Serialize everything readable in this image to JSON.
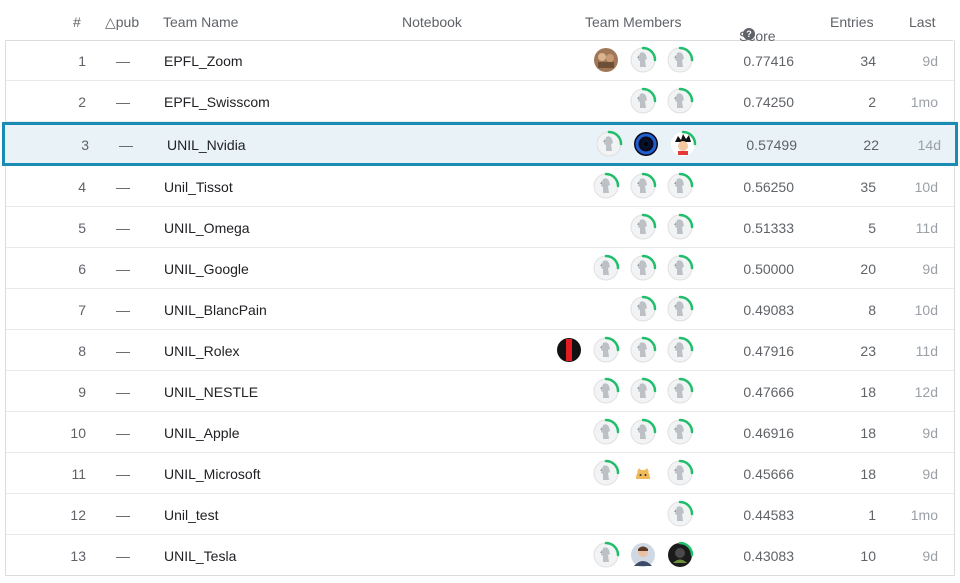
{
  "header": {
    "rank": "#",
    "delta": "△pub",
    "team": "Team Name",
    "notebook": "Notebook",
    "members": "Team Members",
    "score": "Score",
    "entries": "Entries",
    "last": "Last"
  },
  "colors": {
    "highlight_border": "#1a8bb3",
    "highlight_bg": "#e8f2f7",
    "progress_ring": "#20be6b"
  },
  "rows": [
    {
      "rank": "1",
      "delta": "—",
      "team": "EPFL_Zoom",
      "score": "0.77416",
      "entries": "34",
      "last": "9d",
      "members": [
        "photo-avatar",
        "default-avatar",
        "default-avatar"
      ]
    },
    {
      "rank": "2",
      "delta": "—",
      "team": "EPFL_Swisscom",
      "score": "0.74250",
      "entries": "2",
      "last": "1mo",
      "members": [
        "default-avatar",
        "default-avatar"
      ]
    },
    {
      "rank": "3",
      "delta": "—",
      "team": "UNIL_Nvidia",
      "score": "0.57499",
      "entries": "22",
      "last": "14d",
      "members": [
        "default-avatar",
        "vortex-avatar",
        "cartoon-avatar"
      ]
    },
    {
      "rank": "4",
      "delta": "—",
      "team": "Unil_Tissot",
      "score": "0.56250",
      "entries": "35",
      "last": "10d",
      "members": [
        "default-avatar",
        "default-avatar",
        "default-avatar"
      ]
    },
    {
      "rank": "5",
      "delta": "—",
      "team": "UNIL_Omega",
      "score": "0.51333",
      "entries": "5",
      "last": "11d",
      "members": [
        "default-avatar",
        "default-avatar"
      ]
    },
    {
      "rank": "6",
      "delta": "—",
      "team": "UNIL_Google",
      "score": "0.50000",
      "entries": "20",
      "last": "9d",
      "members": [
        "default-avatar",
        "default-avatar",
        "default-avatar"
      ]
    },
    {
      "rank": "7",
      "delta": "—",
      "team": "UNIL_BlancPain",
      "score": "0.49083",
      "entries": "8",
      "last": "10d",
      "members": [
        "default-avatar",
        "default-avatar"
      ]
    },
    {
      "rank": "8",
      "delta": "—",
      "team": "UNIL_Rolex",
      "score": "0.47916",
      "entries": "23",
      "last": "11d",
      "members": [
        "red-stripe-avatar",
        "default-avatar",
        "default-avatar",
        "default-avatar"
      ]
    },
    {
      "rank": "9",
      "delta": "—",
      "team": "UNIL_NESTLE",
      "score": "0.47666",
      "entries": "18",
      "last": "12d",
      "members": [
        "default-avatar",
        "default-avatar",
        "default-avatar"
      ]
    },
    {
      "rank": "10",
      "delta": "—",
      "team": "UNIL_Apple",
      "score": "0.46916",
      "entries": "18",
      "last": "9d",
      "members": [
        "default-avatar",
        "default-avatar",
        "default-avatar"
      ]
    },
    {
      "rank": "11",
      "delta": "—",
      "team": "UNIL_Microsoft",
      "score": "0.45666",
      "entries": "18",
      "last": "9d",
      "members": [
        "default-avatar",
        "cat-avatar",
        "default-avatar"
      ]
    },
    {
      "rank": "12",
      "delta": "—",
      "team": "Unil_test",
      "score": "0.44583",
      "entries": "1",
      "last": "1mo",
      "members": [
        "default-avatar"
      ]
    },
    {
      "rank": "13",
      "delta": "—",
      "team": "UNIL_Tesla",
      "score": "0.43083",
      "entries": "10",
      "last": "9d",
      "members": [
        "default-avatar",
        "person-avatar",
        "dark-avatar"
      ]
    }
  ],
  "highlighted_rank": "3"
}
